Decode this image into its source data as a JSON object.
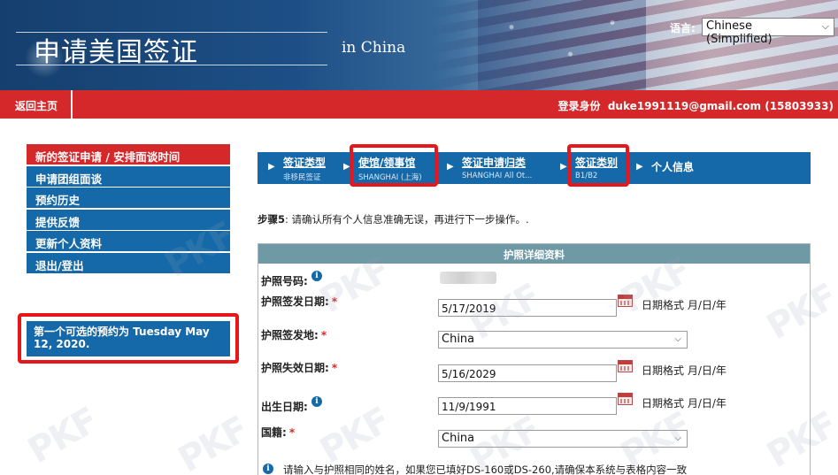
{
  "header": {
    "title": "申请美国签证",
    "subtitle": "in China",
    "language_label": "语言:",
    "language_selected": "Chinese (Simplified)"
  },
  "topbar": {
    "home_label": "返回主页",
    "login_label": "登录身份",
    "login_value": "duke1991119@gmail.com (15803933)"
  },
  "sidebar": {
    "items": [
      {
        "label": "新的签证申请 / 安排面谈时间",
        "active": true
      },
      {
        "label": "申请团组面谈"
      },
      {
        "label": "预约历史"
      },
      {
        "label": "提供反馈"
      },
      {
        "label": "更新个人资料"
      },
      {
        "label": "退出/登出"
      }
    ],
    "appointment_notice": "第一个可选的预约为 Tuesday May 12, 2020."
  },
  "steps": [
    {
      "title": "签证类型",
      "sub": "非移民签证"
    },
    {
      "title": "使馆/领事馆",
      "sub": "SHANGHAI (上海)"
    },
    {
      "title": "签证申请归类",
      "sub": "SHANGHAI All Ot..."
    },
    {
      "title": "签证类别",
      "sub": "B1/B2"
    },
    {
      "title": "个人信息",
      "sub": ""
    }
  ],
  "instruction": {
    "step": "步骤5",
    "text": ": 请确认所有个人信息准确无误，再进行下一步操作。."
  },
  "passport": {
    "section_title": "护照详细资料",
    "number_label": "护照号码:",
    "issue_date_label": "护照签发日期:",
    "issue_date_value": "5/17/2019",
    "issue_place_label": "护照签发地:",
    "issue_place_value": "China",
    "expiry_label": "护照失效日期:",
    "expiry_value": "5/16/2029",
    "birth_label": "出生日期:",
    "birth_value": "11/9/1991",
    "nationality_label": "国籍:",
    "nationality_value": "China",
    "date_format": "日期格式 月/日/年",
    "required_mark": "*",
    "name_note": "请输入与护照相同的姓名，如果您已填好DS-160或DS-260,请确保本系统与表格内容一致"
  },
  "icons": {
    "info": "i",
    "chevron": "⌵",
    "step_arrow": "▶"
  },
  "watermark": "PKF",
  "colors": {
    "nav_blue": "#1569a8",
    "accent_red": "#d4282b",
    "section_header": "#6f9aa5",
    "highlight_red": "#e8151b"
  }
}
